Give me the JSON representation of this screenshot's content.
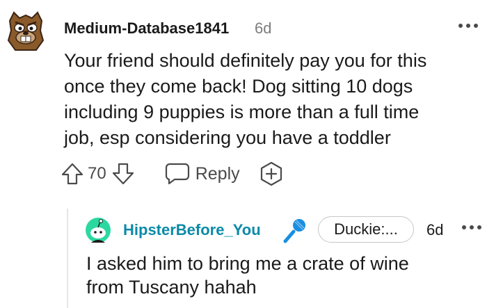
{
  "comment": {
    "author": "Medium-Database1841",
    "age": "6d",
    "body_lines": [
      "Your friend should definitely pay you for this",
      "once they come back! Dog sitting 10 dogs",
      "including 9 puppies is more than a full time",
      "job, esp considering you have a toddler"
    ],
    "score": "70",
    "reply_label": "Reply",
    "icons": {
      "avatar": "beaver-avatar",
      "more": "ellipsis-icon",
      "upvote": "arrow-up-icon",
      "downvote": "arrow-down-icon",
      "reply": "chat-bubble-icon",
      "award": "plus-icon"
    }
  },
  "reply": {
    "author": "HipsterBefore_You",
    "flair": "Duckie:...",
    "age": "6d",
    "body_lines": [
      "I asked him to bring me a crate of wine",
      "from Tuscany hahah"
    ],
    "icons": {
      "avatar": "snoo-avatar",
      "badge": "microphone-icon",
      "more": "ellipsis-icon"
    }
  },
  "colors": {
    "text": "#1a1a1b",
    "muted": "#7c7c7c",
    "reply_author": "#0b8aa8",
    "mic": "#1a8fe0",
    "thread_line": "#e6e6e6"
  }
}
